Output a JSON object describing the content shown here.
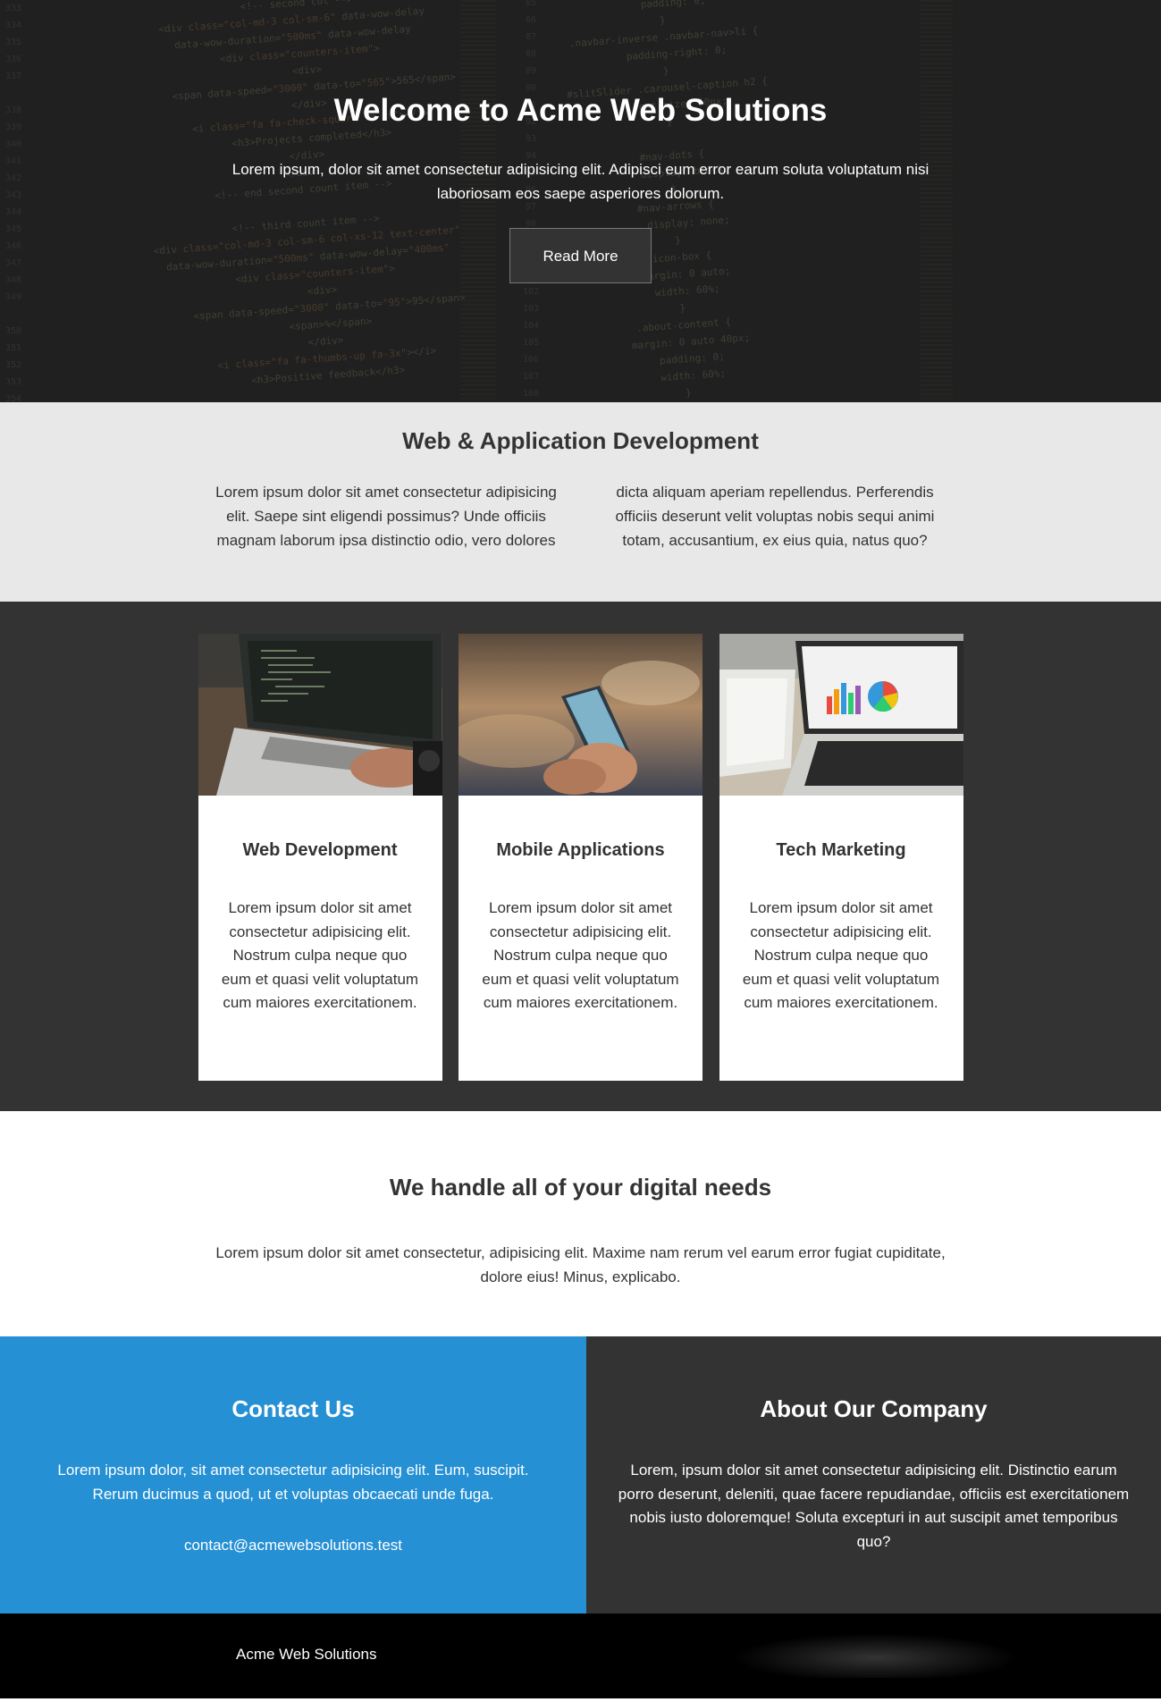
{
  "hero": {
    "title": "Welcome to Acme Web Solutions",
    "text": "Lorem ipsum, dolor sit amet consectetur adipisicing elit. Adipisci eum error earum soluta voluptatum nisi laboriosam eos saepe asperiores dolorum.",
    "button_label": "Read More"
  },
  "webapp": {
    "title": "Web & Application Development",
    "text": "Lorem ipsum dolor sit amet consectetur adipisicing elit. Saepe sint eligendi possimus? Unde officiis magnam laborum ipsa distinctio odio, vero dolores dicta aliquam aperiam repellendus. Perferendis officiis deserunt velit voluptas nobis sequi animi totam, accusantium, ex eius quia, natus quo?"
  },
  "services": [
    {
      "title": "Web Development",
      "text": "Lorem ipsum dolor sit amet consectetur adipisicing elit. Nostrum culpa neque quo eum et quasi velit voluptatum cum maiores exercitationem."
    },
    {
      "title": "Mobile Applications",
      "text": "Lorem ipsum dolor sit amet consectetur adipisicing elit. Nostrum culpa neque quo eum et quasi velit voluptatum cum maiores exercitationem."
    },
    {
      "title": "Tech Marketing",
      "text": "Lorem ipsum dolor sit amet consectetur adipisicing elit. Nostrum culpa neque quo eum et quasi velit voluptatum cum maiores exercitationem."
    }
  ],
  "digital": {
    "title": "We handle all of your digital needs",
    "text": "Lorem ipsum dolor sit amet consectetur, adipisicing elit. Maxime nam rerum vel earum error fugiat cupiditate, dolore eius! Minus, explicabo."
  },
  "contact": {
    "title": "Contact Us",
    "text": "Lorem ipsum dolor, sit amet consectetur adipisicing elit. Eum, suscipit. Rerum ducimus a quod, ut et voluptas obcaecati unde fuga.",
    "email": "contact@acmewebsolutions.test"
  },
  "about": {
    "title": "About Our Company",
    "text": "Lorem, ipsum dolor sit amet consectetur adipisicing elit. Distinctio earum porro deserunt, deleniti, quae facere repudiandae, officiis est exercitationem nobis iusto doloremque! Soluta excepturi in aut suscipit amet temporibus quo?"
  },
  "footer": {
    "brand": "Acme Web Solutions"
  },
  "colors": {
    "hero_bg": "#2b2b2b",
    "section_gray": "#e8e8e8",
    "dark": "#333333",
    "contact_blue": "#2690d4",
    "footer": "#000000"
  }
}
